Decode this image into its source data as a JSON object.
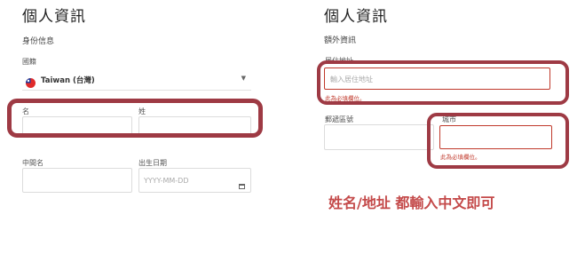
{
  "theme": {
    "highlight": "#9e3a44",
    "error": "#c0392b",
    "note": "#c44a4a",
    "flag_red": "#e02a2a",
    "flag_blue": "#1f3b9c"
  },
  "left": {
    "title": "個人資訊",
    "section": "身份信息",
    "country_label": "國籍",
    "country_value": "Taiwan (台灣)",
    "country_flag_icon": "taiwan-flag-icon",
    "dropdown_icon": "chevron-down-icon",
    "first_name_label": "名",
    "last_name_label": "姓",
    "middle_name_label": "中間名",
    "birth_label": "出生日期",
    "birth_placeholder": "YYYY-MM-DD",
    "calendar_icon": "calendar-icon"
  },
  "right": {
    "title": "個人資訊",
    "section": "額外資訊",
    "address_label": "居住地址",
    "address_placeholder": "輸入居住地址",
    "address_error": "此為必填欄位。",
    "postal_label": "郵遞區號",
    "city_label": "城市",
    "city_error": "此為必填欄位。"
  },
  "note": "姓名/地址 都輸入中文即可"
}
